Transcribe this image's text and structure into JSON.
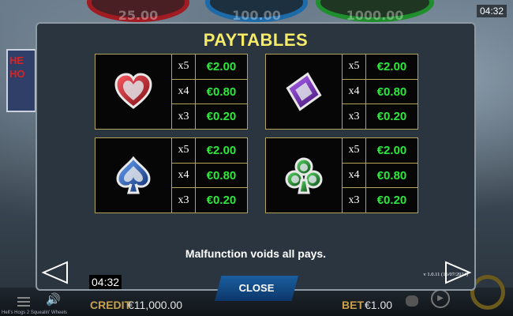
{
  "background": {
    "jackpots": [
      "25.00",
      "100.00",
      "1000.00"
    ],
    "sign_text": "HE HO",
    "top_clock": "04:32",
    "game_title": "Hell's Hogs 2 Squealin' Wheels",
    "credit_label": "CREDIT",
    "credit_value": "€11,000.00",
    "bet_label": "BET",
    "bet_value": "€1.00"
  },
  "panel": {
    "title": "PAYTABLES",
    "cards": [
      {
        "symbol": "heart",
        "color": "#c8202a",
        "rows": [
          {
            "mult": "x5",
            "amount": "€2.00"
          },
          {
            "mult": "x4",
            "amount": "€0.80"
          },
          {
            "mult": "x3",
            "amount": "€0.20"
          }
        ]
      },
      {
        "symbol": "diamond",
        "color": "#7a2fb4",
        "rows": [
          {
            "mult": "x5",
            "amount": "€2.00"
          },
          {
            "mult": "x4",
            "amount": "€0.80"
          },
          {
            "mult": "x3",
            "amount": "€0.20"
          }
        ]
      },
      {
        "symbol": "spade",
        "color": "#2a63c8",
        "rows": [
          {
            "mult": "x5",
            "amount": "€2.00"
          },
          {
            "mult": "x4",
            "amount": "€0.80"
          },
          {
            "mult": "x3",
            "amount": "€0.20"
          }
        ]
      },
      {
        "symbol": "club",
        "color": "#2a9a3a",
        "rows": [
          {
            "mult": "x5",
            "amount": "€2.00"
          },
          {
            "mult": "x4",
            "amount": "€0.80"
          },
          {
            "mult": "x3",
            "amount": "€0.20"
          }
        ]
      }
    ],
    "disclaimer": "Malfunction voids all pays.",
    "version": "v 1.0.11 (16/07/2024)",
    "clock": "04:32",
    "close_label": "CLOSE"
  }
}
